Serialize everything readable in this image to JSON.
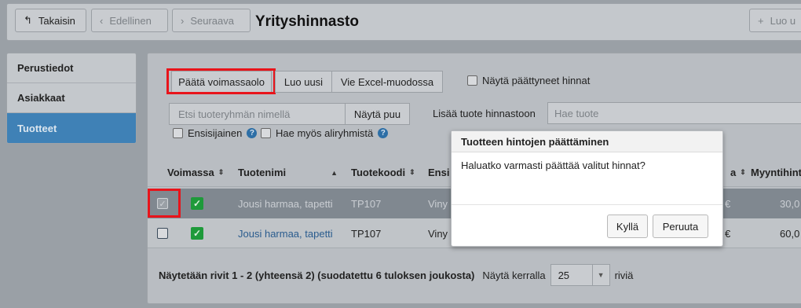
{
  "toolbar": {
    "back_label": "Takaisin",
    "prev_label": "Edellinen",
    "next_label": "Seuraava",
    "title": "Yrityshinnasto",
    "new_label": "Luo u"
  },
  "sidebar": {
    "items": [
      {
        "label": "Perustiedot",
        "active": false
      },
      {
        "label": "Asiakkaat",
        "active": false
      },
      {
        "label": "Tuotteet",
        "active": true
      }
    ]
  },
  "actions": {
    "end_validity": "Päätä voimassaolo",
    "create_new": "Luo uusi",
    "export_excel": "Vie Excel-muodossa",
    "show_ended": "Näytä päättyneet hinnat"
  },
  "filters": {
    "group_placeholder": "Etsi tuoteryhmän nimellä",
    "show_tree": "Näytä puu",
    "primary": "Ensisijainen",
    "search_subgroups": "Hae myös aliryhmistä",
    "add_product_label": "Lisää tuote hinnastoon",
    "product_placeholder": "Hae tuote"
  },
  "table": {
    "headers": {
      "active": "Voimassa",
      "name": "Tuotenimi",
      "code": "Tuotekoodi",
      "ensi": "Ensi",
      "price_a": "a",
      "sales_price": "Myyntihint"
    },
    "rows": [
      {
        "name": "Jousi harmaa, tapetti",
        "code": "TP107",
        "ensi": "Viny",
        "price_a": "€",
        "sales_price": "30,0",
        "selected": true,
        "active": true
      },
      {
        "name": "Jousi harmaa, tapetti",
        "code": "TP107",
        "ensi": "Viny",
        "price_a": "€",
        "sales_price": "60,0",
        "selected": false,
        "active": true
      }
    ]
  },
  "footer": {
    "summary": "Näytetään rivit 1 - 2 (yhteensä 2) (suodatettu 6 tuloksen joukosta)",
    "per_page_label": "Näytä kerralla",
    "per_page_value": "25",
    "rows_suffix": "riviä"
  },
  "dialog": {
    "title": "Tuotteen hintojen päättäminen",
    "message": "Haluatko varmasti päättää valitut hinnat?",
    "confirm": "Kyllä",
    "cancel": "Peruuta"
  },
  "icons": {
    "back": "back-arrow-icon",
    "prev": "chevron-left-icon",
    "next": "chevron-right-icon",
    "add": "plus-icon",
    "help": "question-circle-icon",
    "check": "checkmark-icon"
  },
  "colors": {
    "accent": "#3f81b6",
    "highlight": "#e8141b",
    "active_check": "#1e9a3a"
  }
}
